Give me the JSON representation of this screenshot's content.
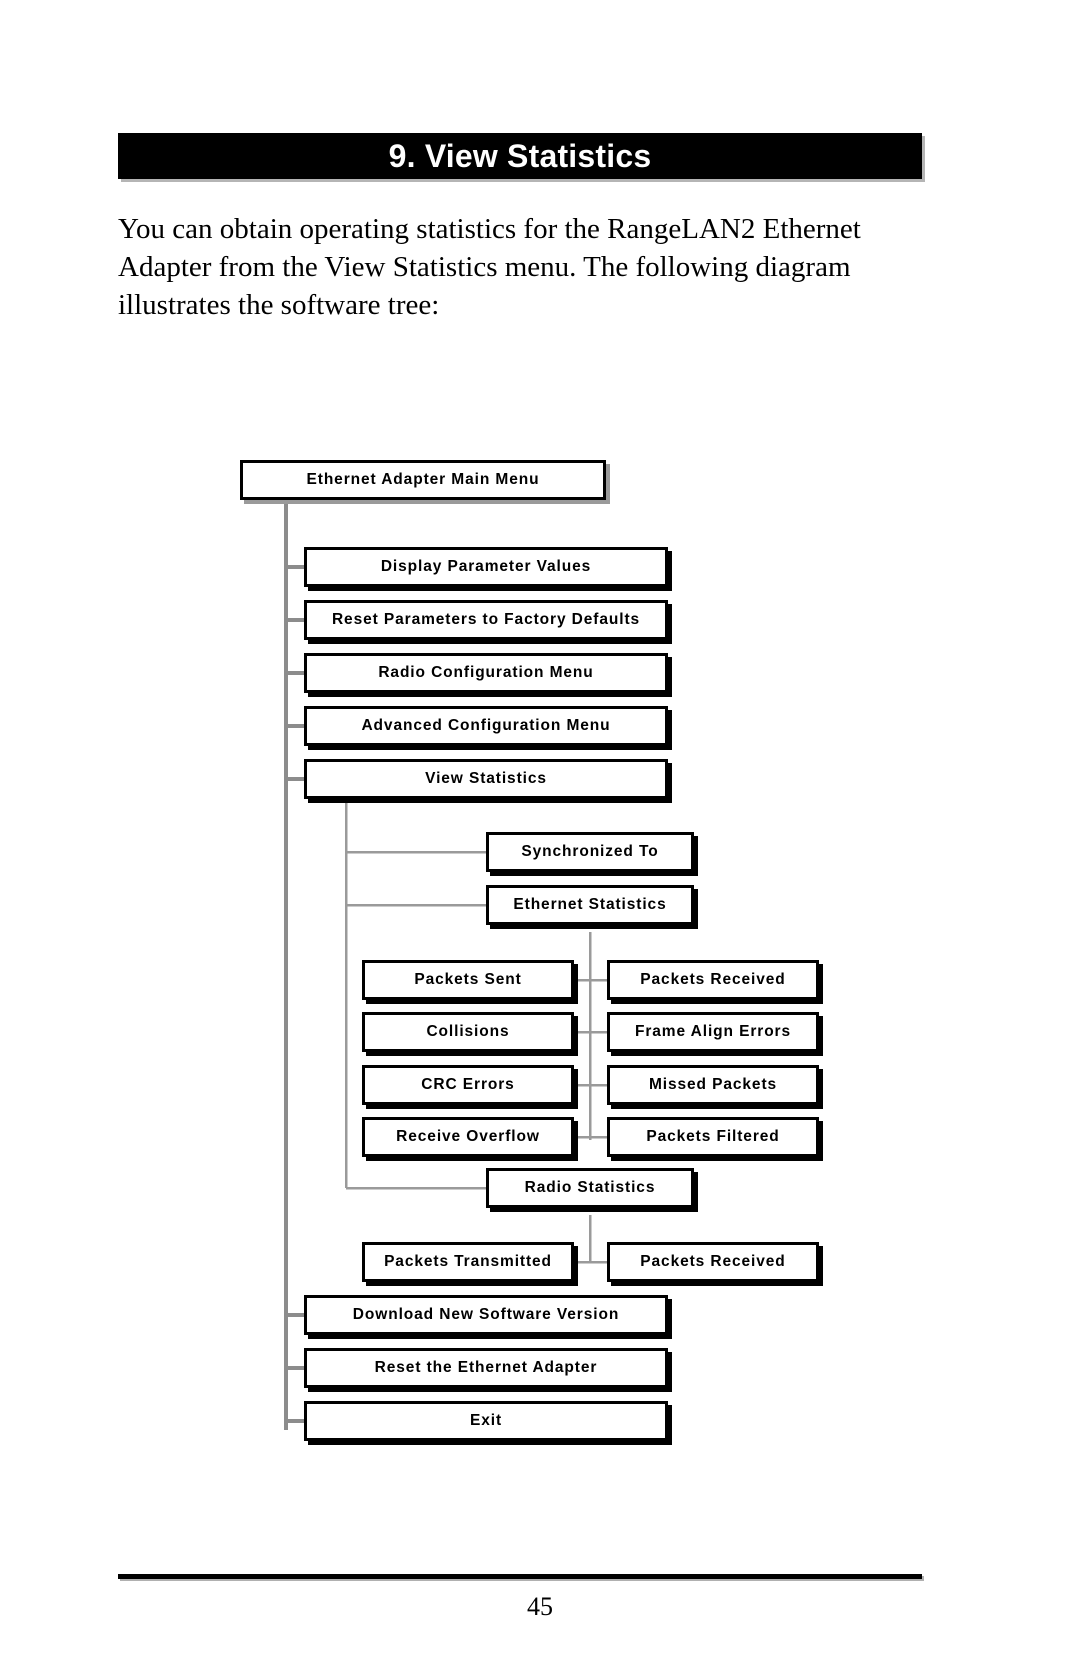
{
  "document": {
    "chapter_title": "9. View Statistics",
    "intro_paragraph": "You can obtain operating statistics for the RangeLAN2 Ethernet Adapter from the View Statistics menu.  The following diagram illustrates the software tree:",
    "page_number": "45"
  },
  "diagram": {
    "title": "Ethernet Adapter software menu tree",
    "nodes": {
      "root": "Ethernet Adapter Main Menu",
      "display_parameter_values": "Display Parameter Values",
      "reset_parameters": "Reset Parameters to Factory Defaults",
      "radio_configuration_menu": "Radio Configuration Menu",
      "advanced_configuration_menu": "Advanced Configuration Menu",
      "view_statistics": "View Statistics",
      "synchronized_to": "Synchronized To",
      "ethernet_statistics": "Ethernet Statistics",
      "packets_sent": "Packets Sent",
      "packets_received_ethernet": "Packets Received",
      "collisions": "Collisions",
      "frame_align_errors": "Frame Align Errors",
      "crc_errors": "CRC Errors",
      "missed_packets": "Missed Packets",
      "receive_overflow": "Receive Overflow",
      "packets_filtered": "Packets Filtered",
      "radio_statistics": "Radio Statistics",
      "packets_transmitted": "Packets Transmitted",
      "packets_received_radio": "Packets Received",
      "download_new_software_version": "Download New Software Version",
      "reset_the_ethernet_adapter": "Reset the Ethernet Adapter",
      "exit": "Exit"
    }
  },
  "colors": {
    "band_background": "#000000",
    "band_text": "#ffffff",
    "node_border": "#000000",
    "node_background": "#ffffff",
    "connector": "#808080",
    "page_background": "#ffffff"
  }
}
